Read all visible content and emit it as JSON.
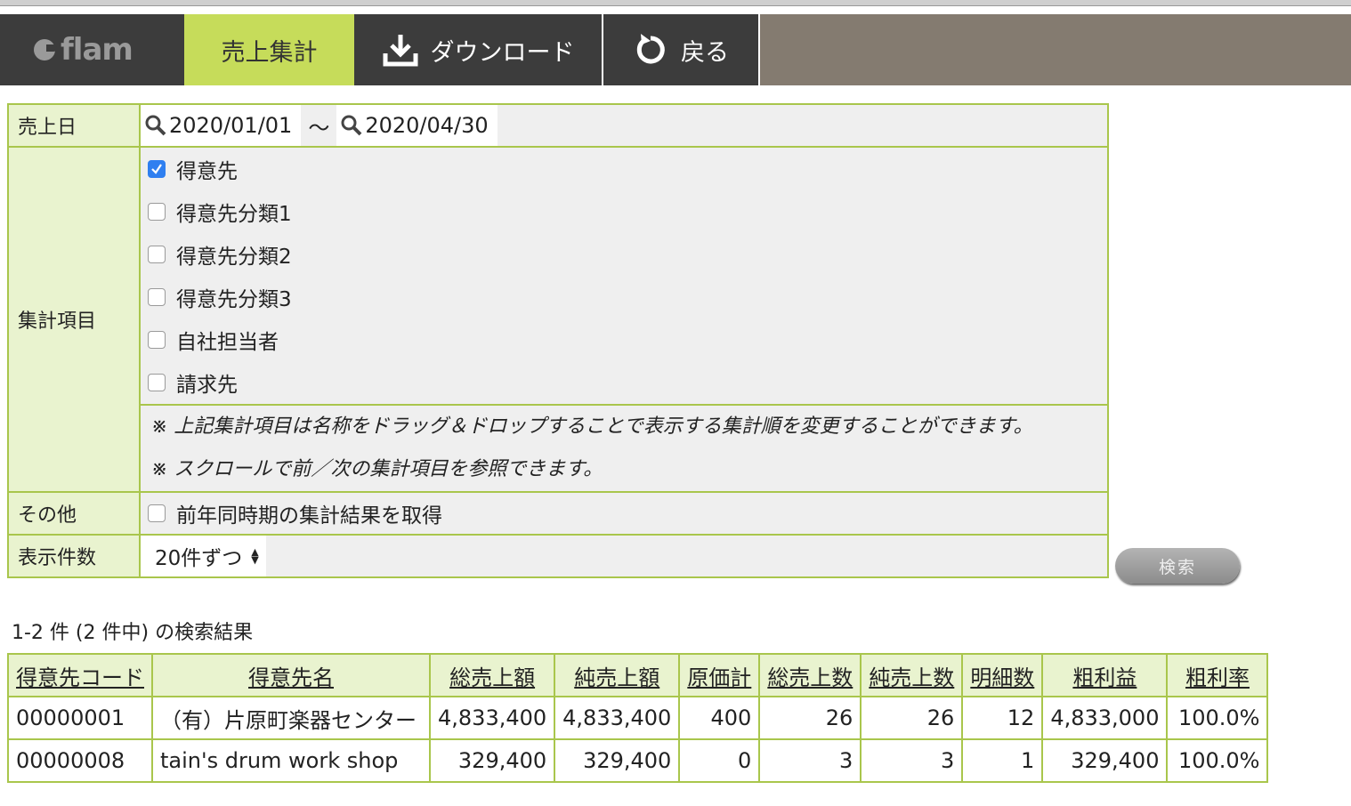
{
  "nav": {
    "logo": "flam",
    "tabs": [
      {
        "label": "売上集計"
      },
      {
        "label": "ダウンロード"
      },
      {
        "label": "戻る"
      }
    ]
  },
  "form": {
    "sales_date": {
      "label": "売上日",
      "from": "2020/01/01",
      "separator": "〜",
      "to": "2020/04/30"
    },
    "aggregation": {
      "label": "集計項目",
      "items": [
        {
          "label": "得意先",
          "checked": true
        },
        {
          "label": "得意先分類1",
          "checked": false
        },
        {
          "label": "得意先分類2",
          "checked": false
        },
        {
          "label": "得意先分類3",
          "checked": false
        },
        {
          "label": "自社担当者",
          "checked": false
        },
        {
          "label": "請求先",
          "checked": false
        }
      ],
      "notes": [
        "※ 上記集計項目は名称をドラッグ＆ドロップすることで表示する集計順を変更することができます。",
        "※ スクロールで前／次の集計項目を参照できます。"
      ]
    },
    "other": {
      "label": "その他",
      "option": "前年同時期の集計結果を取得",
      "checked": false
    },
    "page_size": {
      "label": "表示件数",
      "value": "20件ずつ"
    },
    "search_button": "検索"
  },
  "results": {
    "summary": "1-2 件 (2 件中) の検索結果",
    "columns": [
      "得意先コード",
      "得意先名",
      "総売上額",
      "純売上額",
      "原価計",
      "総売上数",
      "純売上数",
      "明細数",
      "粗利益",
      "粗利率"
    ],
    "rows": [
      [
        "00000001",
        "（有）片原町楽器センター",
        "4,833,400",
        "4,833,400",
        "400",
        "26",
        "26",
        "12",
        "4,833,000",
        "100.0%"
      ],
      [
        "00000008",
        "tain's drum work shop",
        "329,400",
        "329,400",
        "0",
        "3",
        "3",
        "1",
        "329,400",
        "100.0%"
      ]
    ]
  },
  "colors": {
    "accent": "#c6dc5a",
    "border": "#a9c64c",
    "label_bg": "#e9f3cf",
    "nav_bg": "#3c3c3c"
  }
}
